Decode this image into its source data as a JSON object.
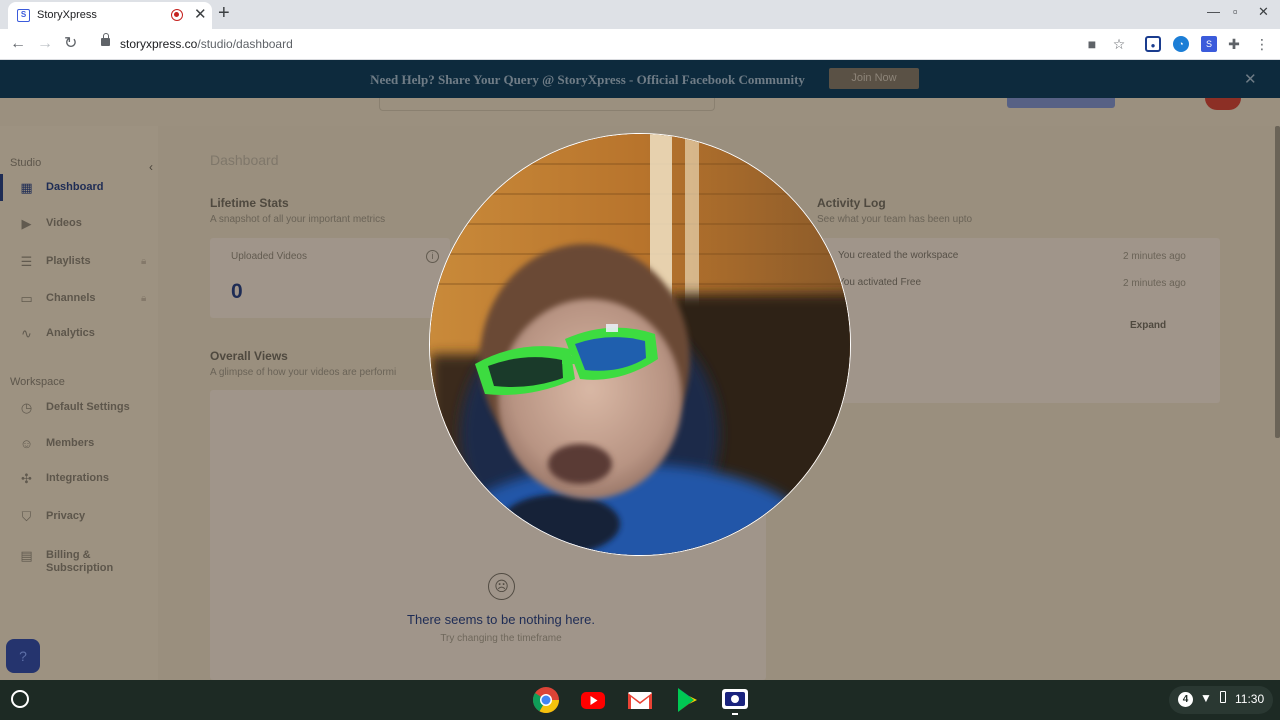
{
  "browser": {
    "tab_title": "StoryXpress",
    "url_domain": "storyxpress.co",
    "url_path": "/studio/dashboard",
    "tab_close": "✕",
    "new_tab": "+"
  },
  "banner": {
    "text": "Need Help? Share Your Query @ StoryXpress - Official Facebook Community",
    "button_label": "Join Now",
    "close": "✕"
  },
  "sidebar": {
    "studio_label": "Studio",
    "workspace_label": "Workspace",
    "studio_items": [
      {
        "label": "Dashboard",
        "icon": "grid-icon",
        "active": true
      },
      {
        "label": "Videos",
        "icon": "video-icon"
      },
      {
        "label": "Playlists",
        "icon": "playlist-icon",
        "locked": true
      },
      {
        "label": "Channels",
        "icon": "channels-icon",
        "locked": true
      },
      {
        "label": "Analytics",
        "icon": "analytics-icon"
      }
    ],
    "workspace_items": [
      {
        "label": "Default Settings",
        "icon": "settings-icon"
      },
      {
        "label": "Members",
        "icon": "members-icon"
      },
      {
        "label": "Integrations",
        "icon": "integrations-icon"
      },
      {
        "label": "Privacy",
        "icon": "shield-icon"
      },
      {
        "label": "Billing & Subscription",
        "icon": "billing-icon"
      }
    ],
    "help_button": "?"
  },
  "main": {
    "page_title": "Dashboard",
    "lifetime_stats": {
      "title": "Lifetime Stats",
      "subtitle": "A snapshot of all your important metrics",
      "uploaded_videos_label": "Uploaded Videos",
      "uploaded_videos_value": "0"
    },
    "overall_views": {
      "title": "Overall Views",
      "subtitle": "A glimpse of how your videos are performi",
      "empty_title": "There seems to be nothing here.",
      "empty_subtitle": "Try changing the timeframe"
    },
    "activity_log": {
      "title": "Activity Log",
      "subtitle": "See what your team has been upto",
      "entries": [
        {
          "text": "You created the workspace",
          "time": "2 minutes ago"
        },
        {
          "text": "You activated Free",
          "time": "2 minutes ago"
        }
      ],
      "expand_label": "Expand"
    }
  },
  "shelf": {
    "apps": [
      "chrome-icon",
      "youtube-icon",
      "gmail-icon",
      "play-store-icon",
      "screen-recorder-icon"
    ],
    "notification_count": "4",
    "time": "11:30"
  }
}
